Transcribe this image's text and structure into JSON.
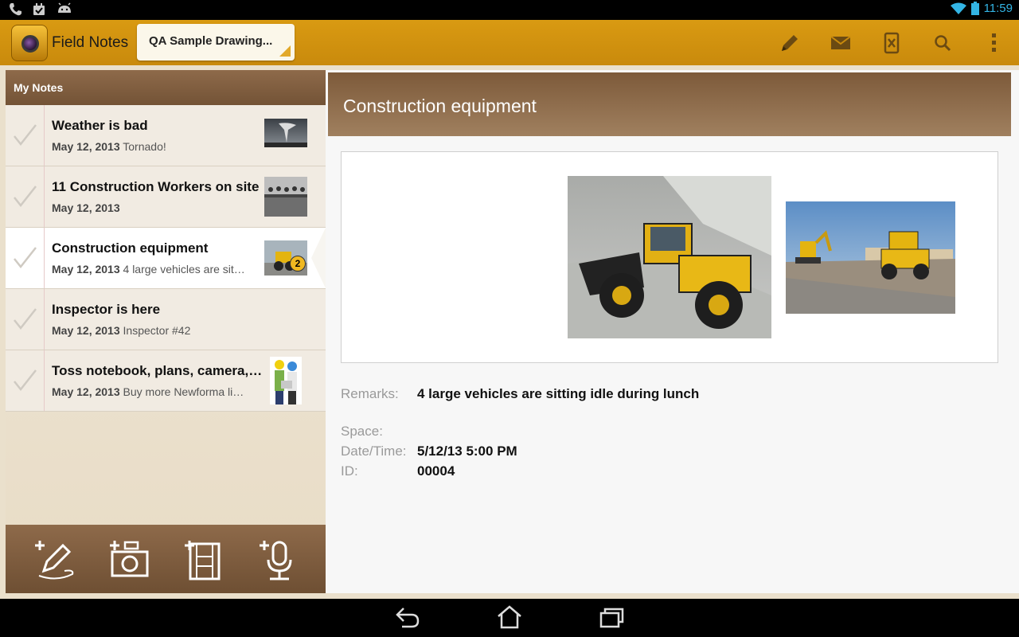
{
  "status_bar": {
    "time": "11:59",
    "left_icons": [
      "phone-icon",
      "calendar-check-icon",
      "android-icon"
    ],
    "right_icons": [
      "wifi-icon",
      "battery-icon"
    ]
  },
  "action_bar": {
    "app_title": "Field Notes",
    "project_spinner": "QA Sample Drawing...",
    "actions": [
      "edit-icon",
      "email-icon",
      "excel-export-icon",
      "search-icon",
      "overflow-menu-icon"
    ],
    "accent_color": "#d99a12"
  },
  "notes_panel": {
    "header": "My Notes",
    "notes": [
      {
        "title": "Weather is bad",
        "date": "May 12, 2013",
        "snippet": "Tornado!",
        "thumbnail": "tornado-photo"
      },
      {
        "title": "11 Construction Workers on site",
        "date": "May 12, 2013",
        "snippet": "",
        "thumbnail": "workers-photo"
      },
      {
        "title": "Construction equipment",
        "date": "May 12, 2013",
        "snippet": "4 large vehicles are sit…",
        "thumbnail": "loader-photo",
        "badge": "2",
        "selected": true
      },
      {
        "title": "Inspector is here",
        "date": "May 12, 2013",
        "snippet": "Inspector #42",
        "thumbnail": ""
      },
      {
        "title": "Toss notebook, plans, camera,…",
        "date": "May 12, 2013",
        "snippet": "Buy more Newforma li…",
        "thumbnail": "engineers-photo"
      }
    ],
    "bottom_actions": [
      "add-text-note-icon",
      "add-photo-note-icon",
      "add-video-note-icon",
      "add-audio-note-icon"
    ]
  },
  "detail": {
    "title": "Construction equipment",
    "photos": [
      "wheel-loader-photo",
      "construction-site-photo"
    ],
    "remarks_label": "Remarks:",
    "remarks_value": "4 large vehicles are sitting idle during lunch",
    "space_label": "Space:",
    "space_value": "",
    "datetime_label": "Date/Time:",
    "datetime_value": "5/12/13 5:00 PM",
    "id_label": "ID:",
    "id_value": "00004"
  },
  "nav_bar": {
    "buttons": [
      "back-icon",
      "home-icon",
      "recent-apps-icon"
    ]
  }
}
